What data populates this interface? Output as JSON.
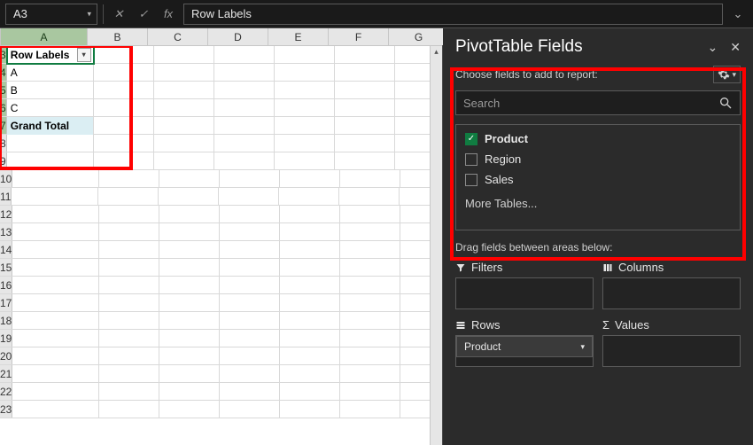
{
  "formula_bar": {
    "name_box_value": "A3",
    "cancel_icon": "✕",
    "confirm_icon": "✓",
    "fx_label": "fx",
    "formula_value": "Row Labels"
  },
  "grid": {
    "columns": [
      "A",
      "B",
      "C",
      "D",
      "E",
      "F",
      "G"
    ],
    "rows": [
      {
        "num": "3",
        "A": "Row Labels",
        "selected": true
      },
      {
        "num": "4",
        "A": "A"
      },
      {
        "num": "5",
        "A": "B"
      },
      {
        "num": "6",
        "A": "C"
      },
      {
        "num": "7",
        "A": "Grand Total",
        "total": true
      },
      {
        "num": "8"
      },
      {
        "num": "9"
      },
      {
        "num": "10"
      },
      {
        "num": "11"
      },
      {
        "num": "12"
      },
      {
        "num": "13"
      },
      {
        "num": "14"
      },
      {
        "num": "15"
      },
      {
        "num": "16"
      },
      {
        "num": "17"
      },
      {
        "num": "18"
      },
      {
        "num": "19"
      },
      {
        "num": "20"
      },
      {
        "num": "21"
      },
      {
        "num": "22"
      },
      {
        "num": "23"
      }
    ]
  },
  "pane": {
    "title": "PivotTable Fields",
    "choose_label": "Choose fields to add to report:",
    "search_placeholder": "Search",
    "fields": [
      {
        "name": "Product",
        "checked": true
      },
      {
        "name": "Region",
        "checked": false
      },
      {
        "name": "Sales",
        "checked": false
      }
    ],
    "more_tables": "More Tables...",
    "drag_hint": "Drag fields between areas below:",
    "areas": {
      "filters": {
        "label": "Filters"
      },
      "columns": {
        "label": "Columns"
      },
      "rows": {
        "label": "Rows",
        "chip": "Product"
      },
      "values": {
        "label": "Values"
      }
    }
  }
}
